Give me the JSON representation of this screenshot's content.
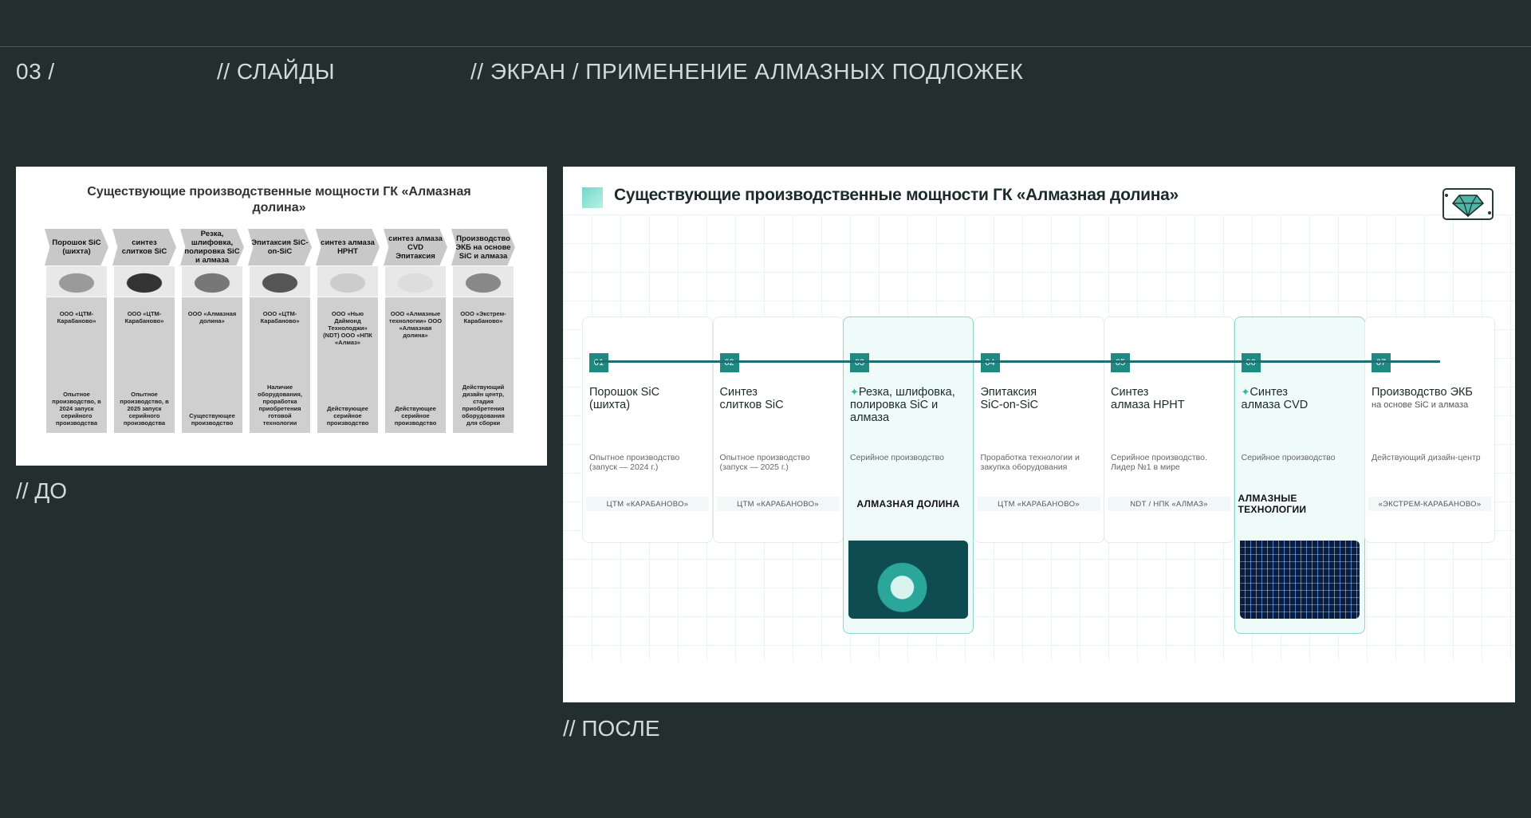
{
  "header": {
    "index": "03 /",
    "section": "// СЛАЙДЫ",
    "screen": "// ЭКРАН / ПРИМЕНЕНИЕ АЛМАЗНЫХ ПОДЛОЖЕК"
  },
  "captions": {
    "before": "// ДО",
    "after": "// ПОСЛЕ"
  },
  "before": {
    "title": "Существующие производственные мощности ГК «Алмазная долина»",
    "columns": [
      {
        "stage": "Порошок SiC (шихта)",
        "company": "ООО «ЦТМ-Карабаново»",
        "status": "Опытное производство, в 2024 запуск серийного производства"
      },
      {
        "stage": "синтез слитков SiC",
        "company": "ООО «ЦТМ-Карабаново»",
        "status": "Опытное производство, в 2025 запуск серийного производства"
      },
      {
        "stage": "Резка, шлифовка, полировка SiC и алмаза",
        "company": "ООО «Алмазная долина»",
        "status": "Существующее производство"
      },
      {
        "stage": "Эпитаксия SiC-on-SiC",
        "company": "ООО «ЦТМ-Карабаново»",
        "status": "Наличие оборудования, проработка приобретения готовой технологии"
      },
      {
        "stage": "синтез алмаза HPHT",
        "company": "ООО «Нью Даймонд Технолоджи» (NDT)  ООО «НПК «Алмаз»",
        "status": "Действующее серийное производство"
      },
      {
        "stage": "синтез алмаза CVD Эпитаксия",
        "company": "ООО «Алмазные технологии»  ООО «Алмазная долина»",
        "status": "Действующее серийное производство"
      },
      {
        "stage": "Производство ЭКБ на основе SiC и алмаза",
        "company": "ООО «Экстрем-Карабаново»",
        "status": "Действующий дизайн центр, стадия приобретения оборудования для сборки"
      }
    ]
  },
  "after": {
    "title": "Существующие производственные мощности ГК «Алмазная долина»",
    "accent": "#1f8a82",
    "stages": [
      {
        "num": "01",
        "title": "Порошок SiC",
        "title2": "(шихта)",
        "sub": "",
        "status": "Опытное производство (запуск — 2024 г.)",
        "company": "ЦТМ «КАРАБАНОВО»",
        "highlight": false
      },
      {
        "num": "02",
        "title": "Синтез",
        "title2": "слитков SiC",
        "sub": "",
        "status": "Опытное производство (запуск — 2025 г.)",
        "company": "ЦТМ «КАРАБАНОВО»",
        "highlight": false
      },
      {
        "num": "03",
        "title": "Резка, шлифовка,",
        "title2": "полировка SiC и алмаза",
        "sub": "",
        "status": "Серийное производство",
        "company": "АЛМАЗНАЯ ДОЛИНА",
        "highlight": true
      },
      {
        "num": "04",
        "title": "Эпитаксия",
        "title2": "SiC-on-SiC",
        "sub": "",
        "status": "Проработка технологии и закупка оборудования",
        "company": "ЦТМ «КАРАБАНОВО»",
        "highlight": false
      },
      {
        "num": "05",
        "title": "Синтез",
        "title2": "алмаза HPHT",
        "sub": "",
        "status": "Серийное производство. Лидер №1 в мире",
        "company": "NDT / НПК «АЛМАЗ»",
        "highlight": false
      },
      {
        "num": "06",
        "title": "Синтез",
        "title2": "алмаза CVD",
        "sub": "",
        "status": "Серийное производство",
        "company": "АЛМАЗНЫЕ ТЕХНОЛОГИИ",
        "highlight": true
      },
      {
        "num": "07",
        "title": "Производство ЭКБ",
        "title2": "",
        "sub": "на основе SiC и алмаза",
        "status": "Действующий дизайн-центр",
        "company": "«ЭКСТРЕМ-КАРАБАНОВО»",
        "highlight": false
      }
    ]
  }
}
